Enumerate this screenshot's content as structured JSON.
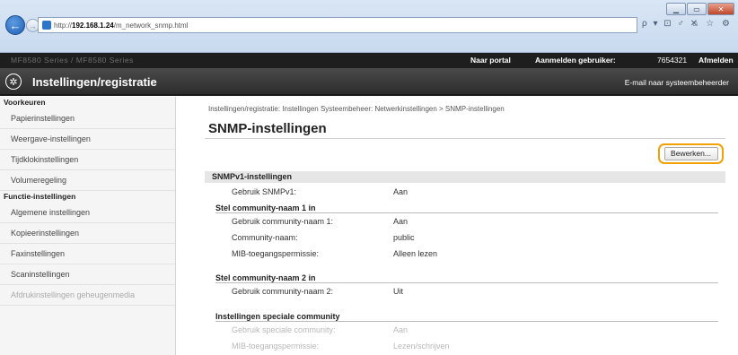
{
  "browser": {
    "url_prefix": "http://",
    "url_host": "192.168.1.24",
    "url_path": "/m_network_snmp.html",
    "addr_tools": "ρ ▾ ⊡ ♂ ✕",
    "star_tools": "⌂ ☆ ⚙"
  },
  "topbar": {
    "device": "MF8580 Series / MF8580 Series",
    "portal": "Naar portal",
    "login_label": "Aanmelden gebruiker:",
    "user": "7654321",
    "logout": "Afmelden"
  },
  "header": {
    "title": "Instellingen/registratie",
    "email": "E-mail naar systeembeheerder"
  },
  "sidebar": {
    "head1": "Voorkeuren",
    "items1": [
      "Papierinstellingen",
      "Weergave-instellingen",
      "Tijdklokinstellingen",
      "Volumeregeling"
    ],
    "head2": "Functie-instellingen",
    "items2": [
      "Algemene instellingen",
      "Kopieerinstellingen",
      "Faxinstellingen",
      "Scaninstellingen",
      "Afdrukinstellingen geheugenmedia"
    ]
  },
  "main": {
    "breadcrumb": "Instellingen/registratie: Instellingen Systeembeheer: Netwerkinstellingen > SNMP-instellingen",
    "title": "SNMP-instellingen",
    "edit_button": "Bewerken...",
    "section": "SNMPv1-instellingen",
    "rows": [
      {
        "label": "Gebruik SNMPv1:",
        "value": "Aan"
      }
    ],
    "community1_head": "Stel community-naam 1 in",
    "community1_rows": [
      {
        "label": "Gebruik community-naam 1:",
        "value": "Aan"
      },
      {
        "label": "Community-naam:",
        "value": "public"
      },
      {
        "label": "MIB-toegangspermissie:",
        "value": "Alleen lezen"
      }
    ],
    "community2_head": "Stel community-naam 2 in",
    "community2_rows": [
      {
        "label": "Gebruik community-naam 2:",
        "value": "Uit"
      }
    ],
    "special_head": "Instellingen speciale community",
    "special_rows": [
      {
        "label": "Gebruik speciale community:",
        "value": "Aan"
      },
      {
        "label": "MIB-toegangspermissie:",
        "value": "Lezen/schrijven"
      }
    ]
  }
}
